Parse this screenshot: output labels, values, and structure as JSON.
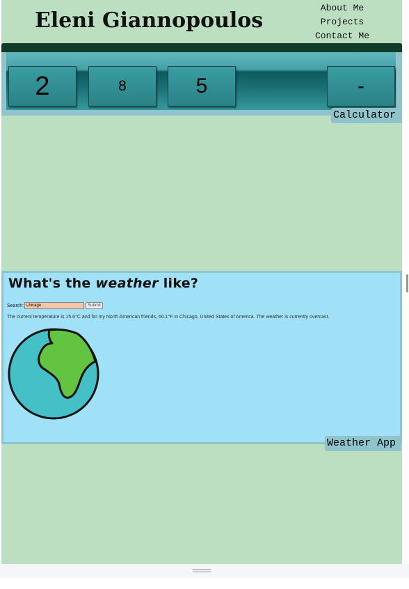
{
  "header": {
    "site_title": "Eleni Giannopoulos",
    "nav": [
      {
        "label": "About Me"
      },
      {
        "label": "Projects"
      },
      {
        "label": "Contact Me"
      }
    ],
    "bar_color": "#123c2a"
  },
  "calculator": {
    "keys": [
      "2",
      "8",
      "5",
      "-"
    ],
    "label": "Calculator"
  },
  "weather": {
    "title_prefix": "What's the ",
    "title_emphasis": "weather",
    "title_suffix": " like?",
    "search_label": "Search:",
    "search_value": "Chicago",
    "submit_label": "Submit",
    "result_text": "The current temperature is 15.6°C and for my North American friends, 60.1°F in Chicago, United States of America. The weather is currently overcast.",
    "label": "Weather App",
    "icon": "globe-icon"
  },
  "colors": {
    "page_bg": "#bcdfc2",
    "calc_panel": "#8fc4cc",
    "weather_bg": "#a0e1f8",
    "search_input_bg": "#f7c6a6"
  }
}
